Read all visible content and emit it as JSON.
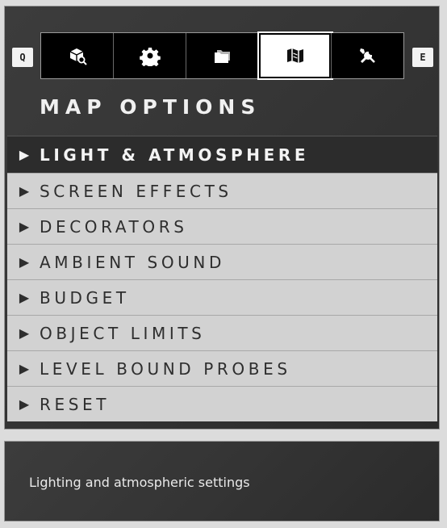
{
  "hints": {
    "left_key": "Q",
    "right_key": "E"
  },
  "tabs": [
    {
      "icon": "object-browser-icon",
      "active": false
    },
    {
      "icon": "settings-gear-icon",
      "active": false
    },
    {
      "icon": "folder-icon",
      "active": false
    },
    {
      "icon": "map-icon",
      "active": true
    },
    {
      "icon": "tools-icon",
      "active": false
    }
  ],
  "title": "MAP OPTIONS",
  "menu": {
    "arrow": "▶",
    "items": [
      {
        "label": "LIGHT & ATMOSPHERE",
        "selected": true
      },
      {
        "label": "SCREEN EFFECTS",
        "selected": false
      },
      {
        "label": "DECORATORS",
        "selected": false
      },
      {
        "label": "AMBIENT SOUND",
        "selected": false
      },
      {
        "label": "BUDGET",
        "selected": false
      },
      {
        "label": "OBJECT LIMITS",
        "selected": false
      },
      {
        "label": "LEVEL BOUND PROBES",
        "selected": false
      },
      {
        "label": "RESET",
        "selected": false
      }
    ]
  },
  "description": "Lighting and atmospheric settings",
  "colors": {
    "panel": "#353535",
    "menu_bg": "#d2d2d2",
    "selected_bg": "#2c2c2c",
    "text_light": "#f0f0f0"
  }
}
